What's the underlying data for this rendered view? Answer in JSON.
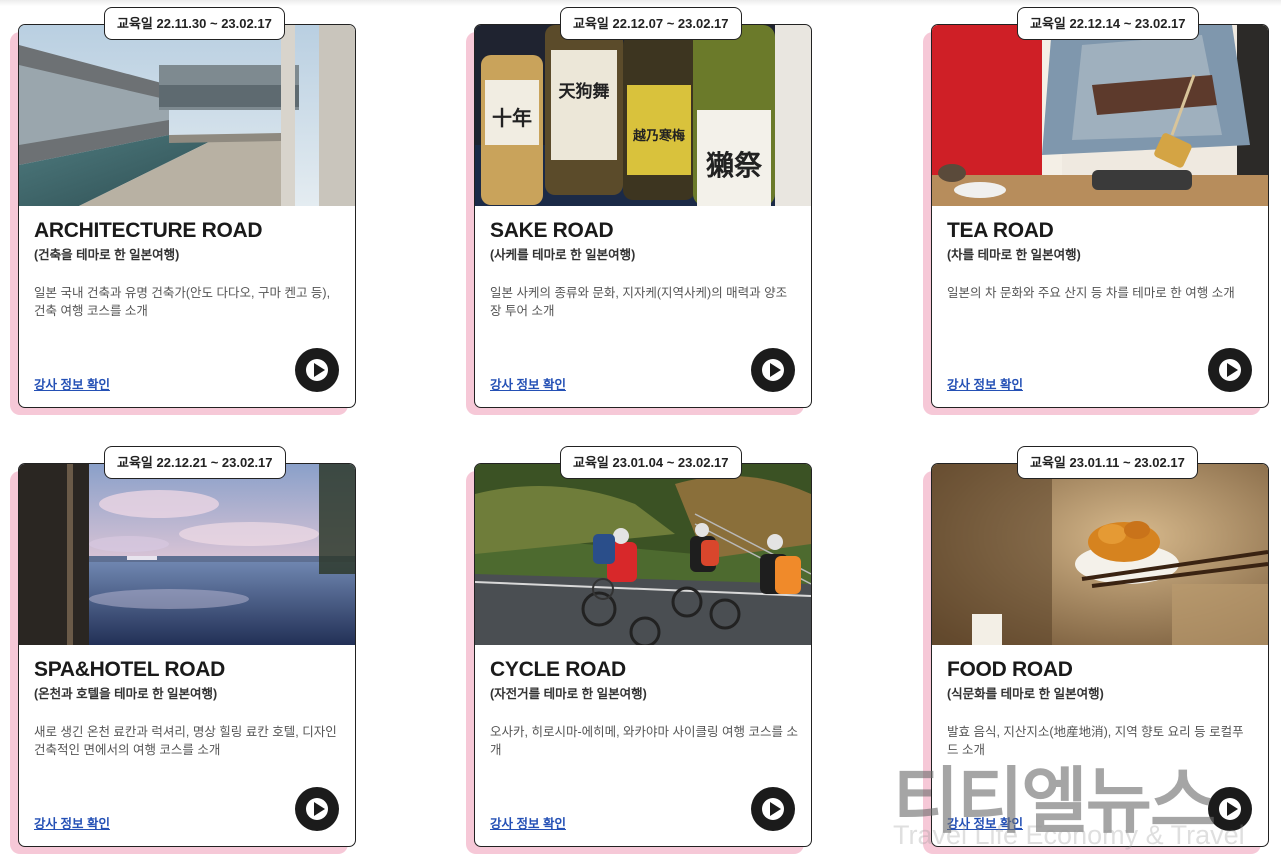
{
  "cards": [
    {
      "date_badge": "교육일 22.11.30 ~ 23.02.17",
      "title": "ARCHITECTURE ROAD",
      "subtitle": "(건축을 테마로 한 일본여행)",
      "description": "일본 국내 건축과 유명 건축가(안도 다다오, 구마 켄고 등), 건축 여행 코스를 소개",
      "link_label": "강사 정보 확인"
    },
    {
      "date_badge": "교육일 22.12.07 ~ 23.02.17",
      "title": "SAKE ROAD",
      "subtitle": "(사케를 테마로 한 일본여행)",
      "description": "일본 사케의 종류와 문화, 지자케(지역사케)의 매력과 양조장 투어 소개",
      "link_label": "강사 정보 확인"
    },
    {
      "date_badge": "교육일 22.12.14 ~ 23.02.17",
      "title": "TEA ROAD",
      "subtitle": "(차를 테마로 한 일본여행)",
      "description": "일본의 차 문화와 주요 산지 등 차를 테마로 한 여행 소개",
      "link_label": "강사 정보 확인"
    },
    {
      "date_badge": "교육일 22.12.21 ~ 23.02.17",
      "title": "SPA&HOTEL ROAD",
      "subtitle": "(온천과 호텔을 테마로 한 일본여행)",
      "description": "새로 생긴 온천 료칸과 럭셔리, 명상 힐링 료칸 호텔, 디자인 건축적인 면에서의 여행 코스를 소개",
      "link_label": "강사 정보 확인"
    },
    {
      "date_badge": "교육일 23.01.04 ~ 23.02.17",
      "title": "CYCLE ROAD",
      "subtitle": "(자전거를 테마로 한 일본여행)",
      "description": "오사카, 히로시마-에히메, 와카야마 사이클링 여행 코스를 소개",
      "link_label": "강사 정보 확인"
    },
    {
      "date_badge": "교육일 23.01.11 ~ 23.02.17",
      "title": "FOOD ROAD",
      "subtitle": "(식문화를 테마로 한 일본여행)",
      "description": "발효 음식, 지산지소(地産地消), 지역 향토 요리 등 로컬푸드 소개",
      "link_label": "강사 정보 확인"
    }
  ],
  "sake_bottle_labels": [
    "十年",
    "天狗舞",
    "越乃寒梅",
    "獺祭"
  ],
  "watermark": {
    "main": "티티엘뉴스",
    "sub": "Travel Life Economy & Travel"
  },
  "colors": {
    "card_shadow": "#f6c8d7",
    "link": "#2450b5",
    "play_button": "#1b1b1b"
  },
  "icons": {
    "play": "play-circle-icon"
  }
}
